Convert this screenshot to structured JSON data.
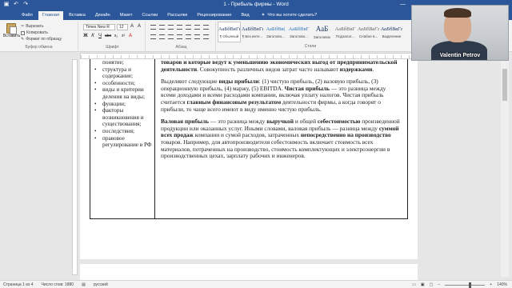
{
  "window": {
    "title": "1 - Прибыль фирмы - Word"
  },
  "quick_access": {
    "save_icon": "save-icon",
    "undo_icon": "undo-icon",
    "redo_icon": "redo-icon"
  },
  "tabs": [
    {
      "label": "Файл"
    },
    {
      "label": "Главная"
    },
    {
      "label": "Вставка"
    },
    {
      "label": "Дизайн"
    },
    {
      "label": "Макет"
    },
    {
      "label": "Ссылки"
    },
    {
      "label": "Рассылки"
    },
    {
      "label": "Рецензирование"
    },
    {
      "label": "Вид"
    }
  ],
  "tell_me": "Что вы хотите сделать?",
  "ribbon": {
    "clipboard": {
      "paste": "Вставить",
      "cut": "Вырезать",
      "copy": "Копировать",
      "format_painter": "Формат по образцу",
      "group_label": "Буфер обмена"
    },
    "font": {
      "name": "Times New R",
      "size": "12",
      "group_label": "Шрифт",
      "row1": [
        "A",
        "A",
        "Aa",
        "A"
      ],
      "row2": [
        "Ж",
        "К",
        "Ч",
        "abc",
        "x₂",
        "x²",
        "A",
        "ab",
        "A"
      ]
    },
    "paragraph": {
      "group_label": "Абзац"
    },
    "styles": {
      "group_label": "Стили",
      "tiles": [
        {
          "sample": "АаБбВвГг,",
          "name": "¶ Обычный"
        },
        {
          "sample": "АаБбВвГг,",
          "name": "¶ Без инте..."
        },
        {
          "sample": "АаБбВв(",
          "name": "Заголово..."
        },
        {
          "sample": "АаБбВвГ",
          "name": "Заголово..."
        },
        {
          "sample": "АаБ",
          "name": "Заголовок"
        },
        {
          "sample": "АаБбВвГ",
          "name": "Подзагол..."
        },
        {
          "sample": "АаБбВвГг",
          "name": "Слабое в..."
        },
        {
          "sample": "АаБбВвГг",
          "name": "Выделение"
        }
      ]
    }
  },
  "document": {
    "left_column": [
      {
        "text": "понятие;",
        "bullet": false
      },
      {
        "text": "структура и содержание;",
        "bullet": true
      },
      {
        "text": "особенности;",
        "bullet": true
      },
      {
        "text": "виды и критерии деления на виды;",
        "bullet": true
      },
      {
        "text": "функции;",
        "bullet": true
      },
      {
        "text": "факторы возникновения и существования;",
        "bullet": true
      },
      {
        "text": "последствия;",
        "bullet": true
      },
      {
        "text": "правовое регулирование в РФ",
        "bullet": true
      }
    ],
    "paragraphs": {
      "p1_a": "товаров и которые ведут к уменьшению экономических выгод от ",
      "p1_b": "предпринимательской деятельности",
      "p1_c": ". Совокупность различных видов затрат часто называют ",
      "p1_d": "издержками",
      "p1_e": ".",
      "p2_a": "Выделяют следующие ",
      "p2_b": "виды прибыли",
      "p2_c": ": (1) чистую прибыль, (2) валовую прибыль, (3) операционную прибыль, (4) маржу, (5) EBITDA. ",
      "p2_d": "Чистая прибыль",
      "p2_e": " — это разница между всеми доходами и всеми расходами компании, включая уплату налогов. Чистая прибыль считается ",
      "p2_f": "главным финансовым результатом",
      "p2_g": " деятельности фирмы, а когда говорят о прибыли, то чаще всего имеют в виду именно чистую прибыль.",
      "p3_a": "Валовая прибыль",
      "p3_b": " — это разница между ",
      "p3_c": "выручкой",
      "p3_d": " и общей ",
      "p3_e": "себестоимостью",
      "p3_f": " произведенной продукции или оказанных услуг. Иными словами, валовая прибыль — разница между ",
      "p3_g": "суммой всех продаж",
      "p3_h": " компании и сумой расходов, затраченных ",
      "p3_i": "непосредственно на производство",
      "p3_j": " товаров. Например, для автопроизводителя себестоимость включает стоимость всех материалов, потраченных на производство, стоимость комплектующих и электроэнергии в производственных цехах, зарплату рабочих и инженеров."
    }
  },
  "status": {
    "page": "Страница 1 из 4",
    "words": "Число слов: 1880",
    "language": "русский",
    "zoom": "140%"
  },
  "webcam": {
    "name": "Valentin Petrov"
  },
  "icons": {
    "minimize": "minimize-icon",
    "maximize": "maximize-icon",
    "close": "close-icon"
  }
}
